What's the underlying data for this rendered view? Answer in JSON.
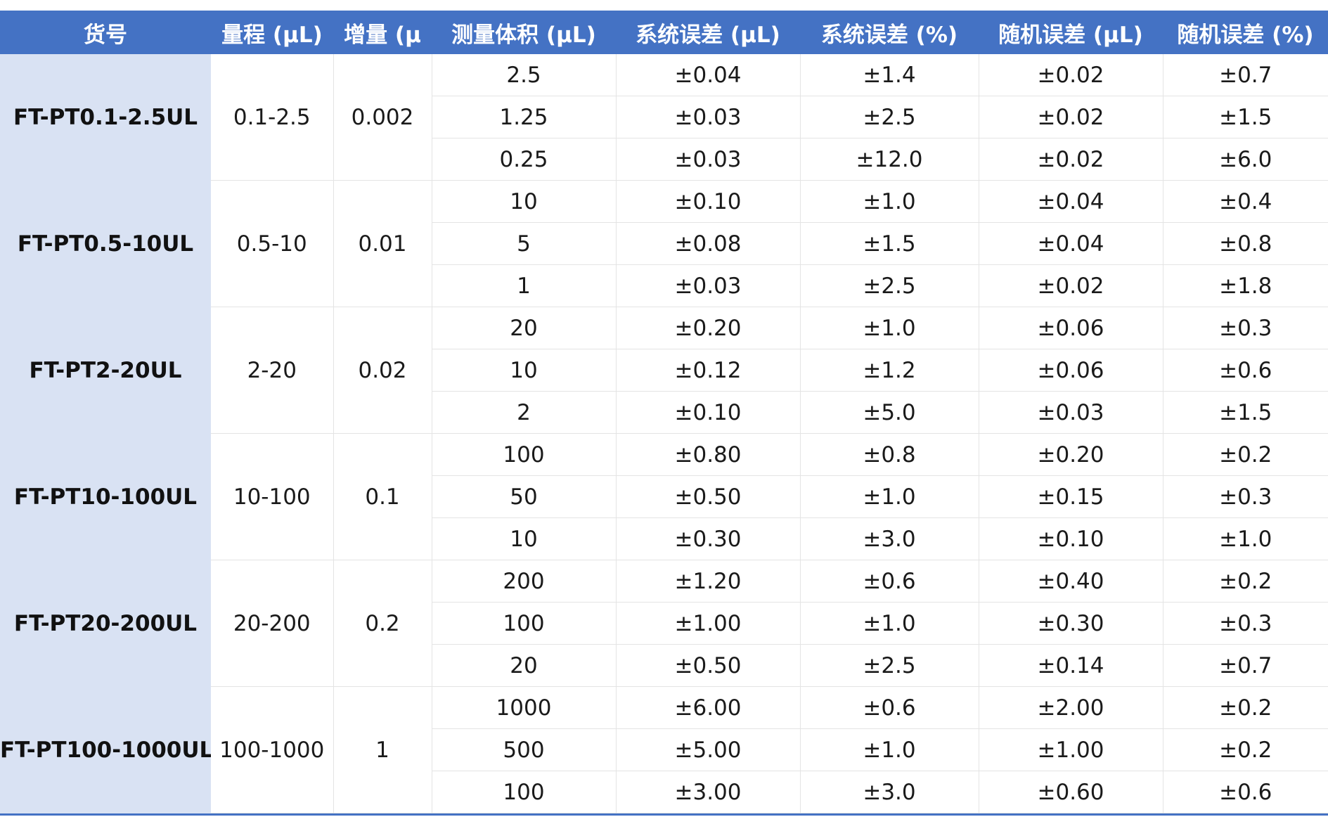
{
  "table": {
    "headers": [
      "货号",
      "量程 (μL)",
      "增量 (μ",
      "测量体积 (μL)",
      "系统误差 (μL)",
      "系统误差 (%)",
      "随机误差 (μL)",
      "随机误差 (%)"
    ],
    "groups": [
      {
        "model": "FT-PT0.1-2.5UL",
        "range": "0.1-2.5",
        "increment": "0.002",
        "rows": [
          {
            "volume": "2.5",
            "sys_ul": "±0.04",
            "sys_pct": "±1.4",
            "rand_ul": "±0.02",
            "rand_pct": "±0.7"
          },
          {
            "volume": "1.25",
            "sys_ul": "±0.03",
            "sys_pct": "±2.5",
            "rand_ul": "±0.02",
            "rand_pct": "±1.5"
          },
          {
            "volume": "0.25",
            "sys_ul": "±0.03",
            "sys_pct": "±12.0",
            "rand_ul": "±0.02",
            "rand_pct": "±6.0"
          }
        ]
      },
      {
        "model": "FT-PT0.5-10UL",
        "range": "0.5-10",
        "increment": "0.01",
        "rows": [
          {
            "volume": "10",
            "sys_ul": "±0.10",
            "sys_pct": "±1.0",
            "rand_ul": "±0.04",
            "rand_pct": "±0.4"
          },
          {
            "volume": "5",
            "sys_ul": "±0.08",
            "sys_pct": "±1.5",
            "rand_ul": "±0.04",
            "rand_pct": "±0.8"
          },
          {
            "volume": "1",
            "sys_ul": "±0.03",
            "sys_pct": "±2.5",
            "rand_ul": "±0.02",
            "rand_pct": "±1.8"
          }
        ]
      },
      {
        "model": "FT-PT2-20UL",
        "range": "2-20",
        "increment": "0.02",
        "rows": [
          {
            "volume": "20",
            "sys_ul": "±0.20",
            "sys_pct": "±1.0",
            "rand_ul": "±0.06",
            "rand_pct": "±0.3"
          },
          {
            "volume": "10",
            "sys_ul": "±0.12",
            "sys_pct": "±1.2",
            "rand_ul": "±0.06",
            "rand_pct": "±0.6"
          },
          {
            "volume": "2",
            "sys_ul": "±0.10",
            "sys_pct": "±5.0",
            "rand_ul": "±0.03",
            "rand_pct": "±1.5"
          }
        ]
      },
      {
        "model": "FT-PT10-100UL",
        "range": "10-100",
        "increment": "0.1",
        "rows": [
          {
            "volume": "100",
            "sys_ul": "±0.80",
            "sys_pct": "±0.8",
            "rand_ul": "±0.20",
            "rand_pct": "±0.2"
          },
          {
            "volume": "50",
            "sys_ul": "±0.50",
            "sys_pct": "±1.0",
            "rand_ul": "±0.15",
            "rand_pct": "±0.3"
          },
          {
            "volume": "10",
            "sys_ul": "±0.30",
            "sys_pct": "±3.0",
            "rand_ul": "±0.10",
            "rand_pct": "±1.0"
          }
        ]
      },
      {
        "model": "FT-PT20-200UL",
        "range": "20-200",
        "increment": "0.2",
        "rows": [
          {
            "volume": "200",
            "sys_ul": "±1.20",
            "sys_pct": "±0.6",
            "rand_ul": "±0.40",
            "rand_pct": "±0.2"
          },
          {
            "volume": "100",
            "sys_ul": "±1.00",
            "sys_pct": "±1.0",
            "rand_ul": "±0.30",
            "rand_pct": "±0.3"
          },
          {
            "volume": "20",
            "sys_ul": "±0.50",
            "sys_pct": "±2.5",
            "rand_ul": "±0.14",
            "rand_pct": "±0.7"
          }
        ]
      },
      {
        "model": "FT-PT100-1000UL",
        "range": "100-1000",
        "increment": "1",
        "rows": [
          {
            "volume": "1000",
            "sys_ul": "±6.00",
            "sys_pct": "±0.6",
            "rand_ul": "±2.00",
            "rand_pct": "±0.2"
          },
          {
            "volume": "500",
            "sys_ul": "±5.00",
            "sys_pct": "±1.0",
            "rand_ul": "±1.00",
            "rand_pct": "±0.2"
          },
          {
            "volume": "100",
            "sys_ul": "±3.00",
            "sys_pct": "±3.0",
            "rand_ul": "±0.60",
            "rand_pct": "±0.6"
          }
        ]
      }
    ]
  },
  "colors": {
    "header_bg": "#4472c4",
    "header_text": "#ffffff",
    "model_col_bg": "#d9e2f3",
    "grid_line": "#e4e4e4"
  }
}
